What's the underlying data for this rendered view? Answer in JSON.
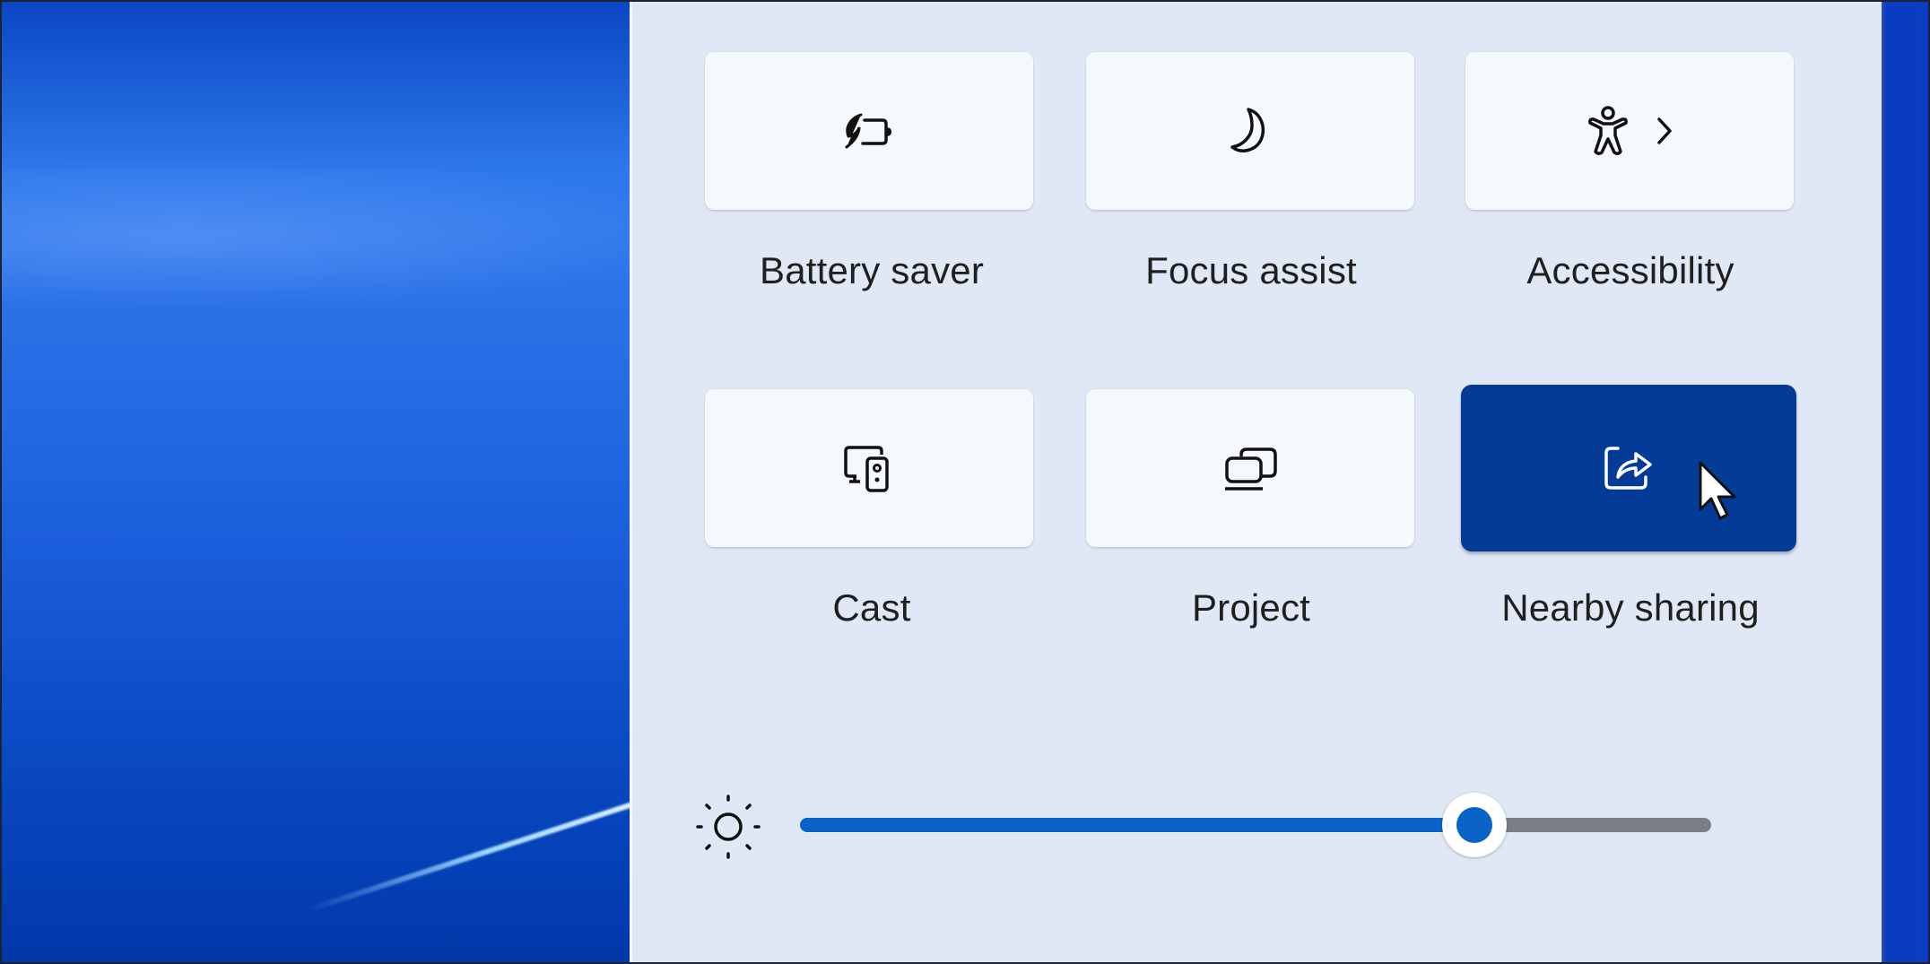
{
  "quick_settings": {
    "tiles": [
      {
        "label": "Battery saver",
        "icon": "battery-saver-leaf-icon",
        "active": false
      },
      {
        "label": "Focus assist",
        "icon": "moon-icon",
        "active": false
      },
      {
        "label": "Accessibility",
        "icon": "accessibility-person-icon",
        "has_submenu": true,
        "submenu_icon": "chevron-right-icon",
        "active": false
      },
      {
        "label": "Cast",
        "icon": "cast-devices-icon",
        "active": false
      },
      {
        "label": "Project",
        "icon": "project-screens-icon",
        "active": false
      },
      {
        "label": "Nearby sharing",
        "icon": "share-icon",
        "active": true
      }
    ],
    "brightness": {
      "icon": "sun-icon",
      "value_percent": 74
    }
  },
  "colors": {
    "accent": "#033b96",
    "slider_fill": "#0a63c9",
    "slider_track": "#7a7d86",
    "panel_background": "#e0e8f6",
    "tile_background": "#f5f8fc"
  }
}
